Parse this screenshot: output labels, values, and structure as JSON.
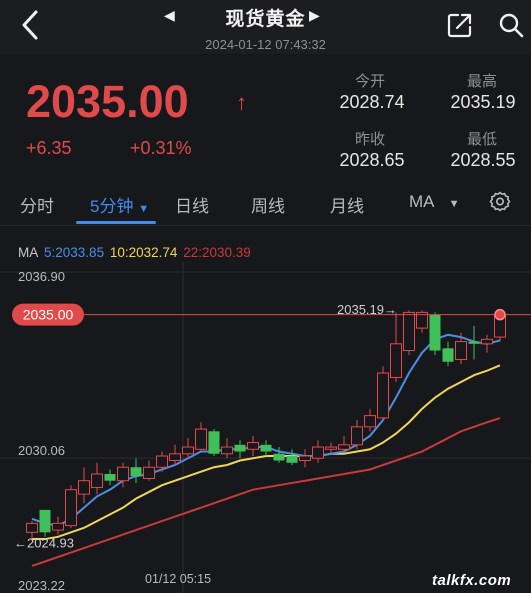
{
  "header": {
    "title": "现货黄金",
    "timestamp": "2024-01-12 07:43:32",
    "icons": [
      "back-icon",
      "prev-arrow-icon",
      "next-arrow-icon",
      "share-icon",
      "search-icon"
    ]
  },
  "quote": {
    "price": "2035.00",
    "arrow": "↑",
    "change": "+6.35",
    "change_pct": "+0.31%",
    "open_label": "今开",
    "open": "2028.74",
    "high_label": "最高",
    "high": "2035.19",
    "prev_close_label": "昨收",
    "prev_close": "2028.65",
    "low_label": "最低",
    "low": "2028.55"
  },
  "tabs": [
    {
      "label": "分时"
    },
    {
      "label": "5分钟",
      "active": true
    },
    {
      "label": "日线"
    },
    {
      "label": "周线"
    },
    {
      "label": "月线"
    },
    {
      "label": "MA"
    }
  ],
  "ma_legend": {
    "prefix": "MA",
    "ma5": "5:2033.85",
    "ma10": "10:2032.74",
    "ma22": "22:2030.39"
  },
  "colors": {
    "up": "#e04a4a",
    "down": "#3fc05a",
    "accent": "#3f8cf0",
    "ma5": "#4a8fe6",
    "ma10": "#f0d55a",
    "ma22": "#c83a3a"
  },
  "chart_data": {
    "type": "candlestick",
    "ylim": [
      2023.22,
      2036.9
    ],
    "y_labels": [
      "2036.90",
      "2030.06",
      "2023.22"
    ],
    "x_labels": [
      "01/12 05:15"
    ],
    "current_price_label": "2035.00",
    "high_marker": "2035.19→",
    "low_marker": "←2024.93",
    "candles": [
      {
        "o": 2025.3,
        "c": 2025.7,
        "h": 2025.8,
        "l": 2024.9
      },
      {
        "o": 2026.3,
        "c": 2025.3,
        "h": 2026.3,
        "l": 2025.1
      },
      {
        "o": 2025.4,
        "c": 2025.7,
        "h": 2026.0,
        "l": 2025.2
      },
      {
        "o": 2025.6,
        "c": 2027.2,
        "h": 2027.4,
        "l": 2025.5
      },
      {
        "o": 2027.0,
        "c": 2027.6,
        "h": 2028.2,
        "l": 2026.6
      },
      {
        "o": 2027.3,
        "c": 2027.9,
        "h": 2028.4,
        "l": 2027.0
      },
      {
        "o": 2027.9,
        "c": 2027.6,
        "h": 2028.1,
        "l": 2027.4
      },
      {
        "o": 2027.6,
        "c": 2028.2,
        "h": 2028.4,
        "l": 2027.3
      },
      {
        "o": 2028.2,
        "c": 2027.8,
        "h": 2028.6,
        "l": 2027.5
      },
      {
        "o": 2027.7,
        "c": 2028.2,
        "h": 2028.5,
        "l": 2027.6
      },
      {
        "o": 2028.2,
        "c": 2028.7,
        "h": 2028.9,
        "l": 2028.0
      },
      {
        "o": 2028.5,
        "c": 2028.8,
        "h": 2029.2,
        "l": 2028.3
      },
      {
        "o": 2028.8,
        "c": 2029.1,
        "h": 2029.5,
        "l": 2028.6
      },
      {
        "o": 2029.0,
        "c": 2029.9,
        "h": 2030.2,
        "l": 2028.9
      },
      {
        "o": 2029.8,
        "c": 2028.8,
        "h": 2029.9,
        "l": 2028.7
      },
      {
        "o": 2028.8,
        "c": 2029.1,
        "h": 2029.5,
        "l": 2028.6
      },
      {
        "o": 2029.2,
        "c": 2028.9,
        "h": 2029.4,
        "l": 2028.6
      },
      {
        "o": 2029.0,
        "c": 2029.3,
        "h": 2029.6,
        "l": 2028.7
      },
      {
        "o": 2029.2,
        "c": 2028.9,
        "h": 2029.4,
        "l": 2028.7
      },
      {
        "o": 2028.8,
        "c": 2028.5,
        "h": 2029.1,
        "l": 2028.4
      },
      {
        "o": 2028.7,
        "c": 2028.4,
        "h": 2029.0,
        "l": 2028.3
      },
      {
        "o": 2028.5,
        "c": 2028.7,
        "h": 2029.0,
        "l": 2028.2
      },
      {
        "o": 2028.6,
        "c": 2029.1,
        "h": 2029.4,
        "l": 2028.4
      },
      {
        "o": 2029.0,
        "c": 2029.1,
        "h": 2029.3,
        "l": 2028.8
      },
      {
        "o": 2029.0,
        "c": 2029.2,
        "h": 2029.6,
        "l": 2028.9
      },
      {
        "o": 2029.2,
        "c": 2030.0,
        "h": 2030.3,
        "l": 2029.0
      },
      {
        "o": 2030.0,
        "c": 2030.5,
        "h": 2030.8,
        "l": 2029.8
      },
      {
        "o": 2030.4,
        "c": 2032.4,
        "h": 2032.7,
        "l": 2030.3
      },
      {
        "o": 2032.2,
        "c": 2033.7,
        "h": 2035.1,
        "l": 2032.0
      },
      {
        "o": 2033.4,
        "c": 2035.1,
        "h": 2035.19,
        "l": 2033.2
      },
      {
        "o": 2034.4,
        "c": 2035.1,
        "h": 2035.19,
        "l": 2034.2
      },
      {
        "o": 2035.0,
        "c": 2033.4,
        "h": 2035.1,
        "l": 2033.2
      },
      {
        "o": 2033.5,
        "c": 2032.9,
        "h": 2033.8,
        "l": 2032.7
      },
      {
        "o": 2033.0,
        "c": 2033.8,
        "h": 2034.2,
        "l": 2032.8
      },
      {
        "o": 2033.8,
        "c": 2033.7,
        "h": 2034.5,
        "l": 2033.0
      },
      {
        "o": 2033.7,
        "c": 2033.9,
        "h": 2034.1,
        "l": 2033.3
      },
      {
        "o": 2034.0,
        "c": 2035.0,
        "h": 2035.2,
        "l": 2033.8
      }
    ],
    "ma5": [
      2025.9,
      2025.7,
      2025.6,
      2025.9,
      2026.4,
      2026.9,
      2027.2,
      2027.6,
      2027.8,
      2027.9,
      2028.1,
      2028.3,
      2028.6,
      2028.9,
      2028.9,
      2029.0,
      2029.0,
      2029.1,
      2029.1,
      2028.9,
      2028.8,
      2028.7,
      2028.7,
      2028.8,
      2028.9,
      2029.2,
      2029.6,
      2030.3,
      2031.3,
      2032.4,
      2033.3,
      2033.9,
      2034.1,
      2034.0,
      2033.8,
      2033.7,
      2033.85
    ],
    "ma10": [
      2025.0,
      2025.0,
      2025.1,
      2025.3,
      2025.5,
      2025.8,
      2026.1,
      2026.4,
      2026.8,
      2027.1,
      2027.4,
      2027.6,
      2027.8,
      2028.0,
      2028.2,
      2028.3,
      2028.5,
      2028.6,
      2028.7,
      2028.7,
      2028.7,
      2028.7,
      2028.7,
      2028.8,
      2028.8,
      2028.9,
      2029.0,
      2029.3,
      2029.7,
      2030.2,
      2030.8,
      2031.3,
      2031.7,
      2032.0,
      2032.3,
      2032.5,
      2032.74
    ],
    "ma22": [
      2023.8,
      2024.0,
      2024.2,
      2024.4,
      2024.6,
      2024.8,
      2025.0,
      2025.2,
      2025.4,
      2025.6,
      2025.8,
      2026.0,
      2026.2,
      2026.4,
      2026.6,
      2026.8,
      2027.0,
      2027.2,
      2027.3,
      2027.4,
      2027.5,
      2027.6,
      2027.7,
      2027.8,
      2027.9,
      2028.0,
      2028.1,
      2028.3,
      2028.5,
      2028.7,
      2028.9,
      2029.2,
      2029.5,
      2029.8,
      2030.0,
      2030.2,
      2030.39
    ]
  },
  "watermark": "talkfx.com"
}
